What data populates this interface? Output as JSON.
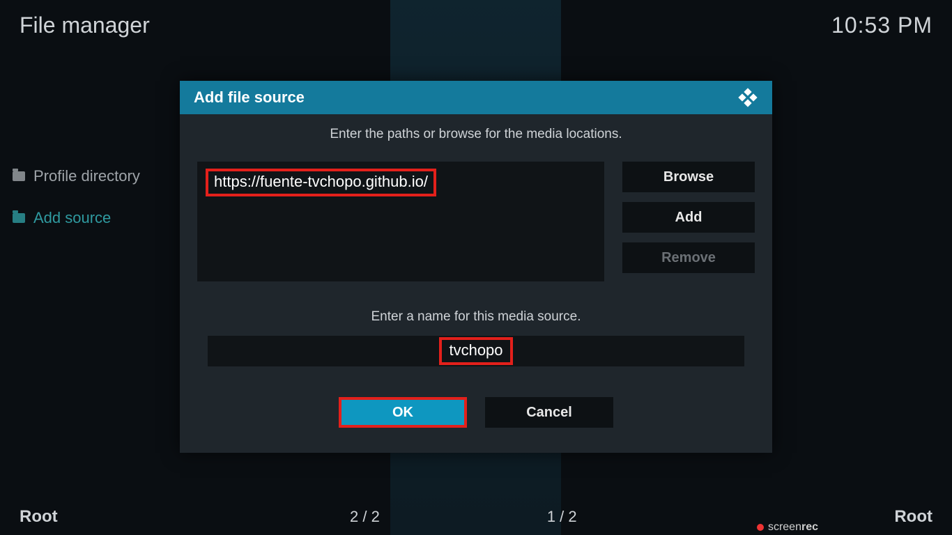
{
  "header": {
    "title": "File manager",
    "clock": "10:53 PM"
  },
  "sidebar": {
    "items": [
      {
        "label": "Profile directory"
      },
      {
        "label": "Add source"
      }
    ]
  },
  "dialog": {
    "title": "Add file source",
    "instruction_paths": "Enter the paths or browse for the media locations.",
    "url": "https://fuente-tvchopo.github.io/",
    "buttons": {
      "browse": "Browse",
      "add": "Add",
      "remove": "Remove"
    },
    "instruction_name": "Enter a name for this media source.",
    "source_name": "tvchopo",
    "ok": "OK",
    "cancel": "Cancel"
  },
  "footer": {
    "left_root": "Root",
    "counter_left": "2 / 2",
    "counter_right": "1 / 2",
    "right_root": "Root"
  },
  "watermark": {
    "part1": "screen",
    "part2": "rec"
  }
}
